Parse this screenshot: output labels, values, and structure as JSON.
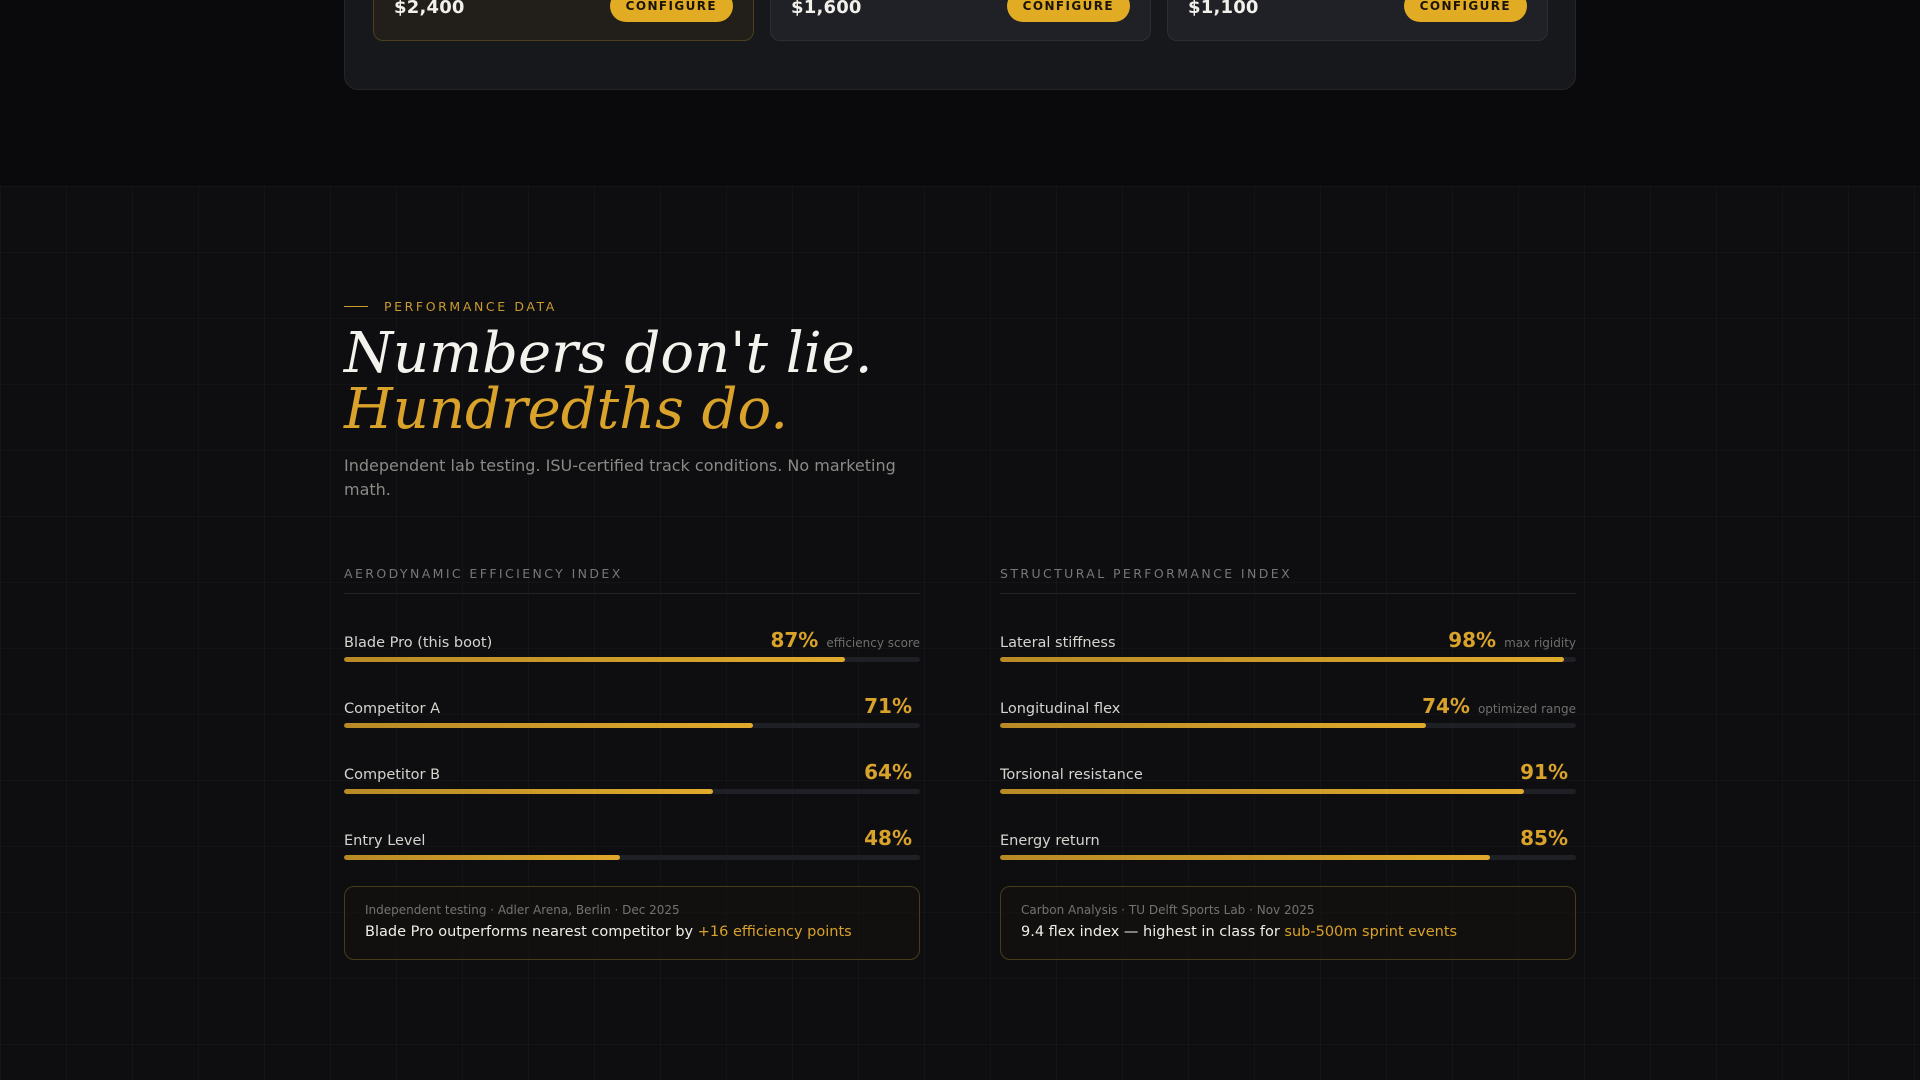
{
  "pricing": {
    "tiers": [
      {
        "price": "$2,400",
        "button": "CONFIGURE",
        "featured": true
      },
      {
        "price": "$1,600",
        "button": "CONFIGURE",
        "featured": false
      },
      {
        "price": "$1,100",
        "button": "CONFIGURE",
        "featured": false
      }
    ]
  },
  "performance": {
    "eyebrow": "PERFORMANCE DATA",
    "headline_line1": "Numbers don't lie.",
    "headline_line2": "Hundredths do.",
    "subtext": "Independent lab testing. ISU-certified track conditions. No marketing math.",
    "aero": {
      "title": "AERODYNAMIC EFFICIENCY INDEX",
      "metrics": [
        {
          "label": "Blade Pro (this boot)",
          "value": "87%",
          "note": "efficiency score",
          "percent": 87
        },
        {
          "label": "Competitor A",
          "value": "71%",
          "note": "",
          "percent": 71
        },
        {
          "label": "Competitor B",
          "value": "64%",
          "note": "",
          "percent": 64
        },
        {
          "label": "Entry Level",
          "value": "48%",
          "note": "",
          "percent": 48
        }
      ],
      "callout": {
        "meta": "Independent testing · Adler Arena, Berlin · Dec 2025",
        "text": "Blade Pro outperforms nearest competitor by ",
        "highlight": "+16 efficiency points"
      }
    },
    "structural": {
      "title": "STRUCTURAL PERFORMANCE INDEX",
      "metrics": [
        {
          "label": "Lateral stiffness",
          "value": "98%",
          "note": "max rigidity",
          "percent": 98
        },
        {
          "label": "Longitudinal flex",
          "value": "74%",
          "note": "optimized range",
          "percent": 74
        },
        {
          "label": "Torsional resistance",
          "value": "91%",
          "note": "",
          "percent": 91
        },
        {
          "label": "Energy return",
          "value": "85%",
          "note": "",
          "percent": 85
        }
      ],
      "callout": {
        "meta": "Carbon Analysis · TU Delft Sports Lab · Nov 2025",
        "text": "9.4 flex index — highest in class for ",
        "highlight": "sub-500m sprint events"
      }
    }
  }
}
